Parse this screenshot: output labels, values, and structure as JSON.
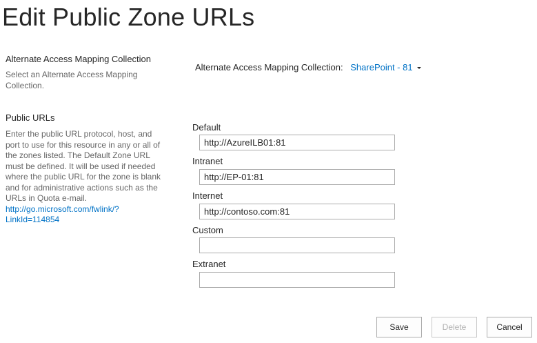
{
  "page": {
    "title": "Edit Public Zone URLs"
  },
  "aam_section": {
    "heading": "Alternate Access Mapping Collection",
    "description": "Select an Alternate Access Mapping Collection.",
    "field_label": "Alternate Access Mapping Collection:",
    "selected_value": "SharePoint - 81"
  },
  "public_urls_section": {
    "heading": "Public URLs",
    "description": "Enter the public URL protocol, host, and port to use for this resource in any or all of the zones listed.  The Default Zone URL must be defined.  It will be used if needed where the public URL for the zone is blank and for administrative actions such as the URLs in Quota e-mail.",
    "help_link": "http://go.microsoft.com/fwlink/?LinkId=114854"
  },
  "zones": {
    "default": {
      "label": "Default",
      "value": "http://AzureILB01:81"
    },
    "intranet": {
      "label": "Intranet",
      "value": "http://EP-01:81"
    },
    "internet": {
      "label": "Internet",
      "value": "http://contoso.com:81"
    },
    "custom": {
      "label": "Custom",
      "value": ""
    },
    "extranet": {
      "label": "Extranet",
      "value": ""
    }
  },
  "buttons": {
    "save": "Save",
    "delete": "Delete",
    "cancel": "Cancel"
  }
}
